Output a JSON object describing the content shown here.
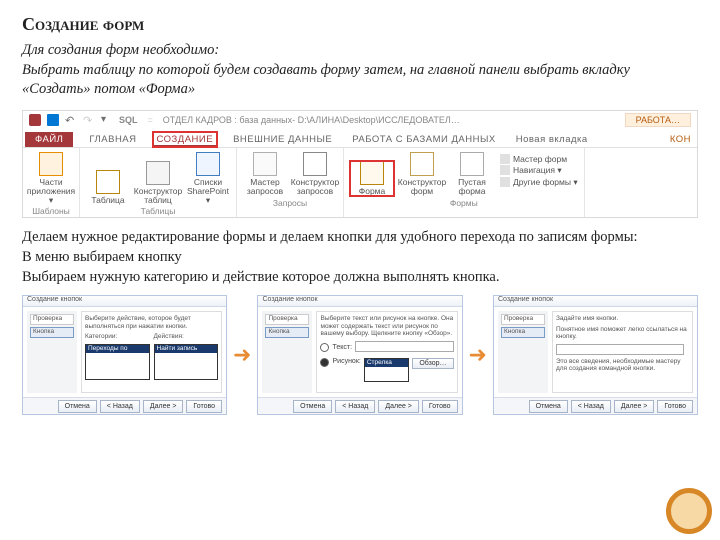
{
  "heading": "Создание форм",
  "intro": "Для создания форм необходимо:\nВыбрать таблицу по которой будем создавать форму затем, на главной панели выбрать вкладку «Создать» потом «Форма»",
  "ribbon": {
    "qat": {
      "sql": "SQL",
      "sep": "=",
      "title": "ОТДЕЛ КАДРОВ : база данных- D:\\АЛИНА\\Desktop\\ИССЛЕДОВАТЕЛ…",
      "context": "РАБОТА…"
    },
    "tabs": {
      "file": "ФАЙЛ",
      "home": "ГЛАВНАЯ",
      "create": "СОЗДАНИЕ",
      "external": "ВНЕШНИЕ ДАННЫЕ",
      "dbtools": "РАБОТА С БАЗАМИ ДАННЫХ",
      "newtab": "Новая вкладка",
      "constr": "КОН"
    },
    "groups": {
      "templates": {
        "label": "Шаблоны",
        "app": "Части приложения ▾"
      },
      "tables": {
        "label": "Таблицы",
        "table": "Таблица",
        "ctor": "Конструктор таблиц",
        "lists": "Списки SharePoint ▾"
      },
      "queries": {
        "label": "Запросы",
        "wizard": "Мастер запросов",
        "ctor": "Конструктор запросов"
      },
      "forms": {
        "label": "Формы",
        "form": "Форма",
        "ctor": "Конструктор форм",
        "blank": "Пустая форма",
        "stack": {
          "wizard": "Мастер форм",
          "nav": "Навигация ▾",
          "other": "Другие формы ▾"
        }
      }
    }
  },
  "body_text": "Делаем нужное редактирование формы и делаем кнопки для удобного перехода по записям формы:\nВ меню выбираем кнопку\nВыбираем нужную категорию и действие которое должна выполнять кнопка.",
  "dialogs": {
    "d1": {
      "title": "Создание кнопок",
      "side_label": "Проверка",
      "side_sel": "Кнопка",
      "text1": "Выберите действие, которое будет выполняться при нажатии кнопки.",
      "cat_label": "Категории:",
      "act_label": "Действия:",
      "cat_item": "Переходы по записям",
      "act_item": "Найти запись"
    },
    "d2": {
      "title": "Создание кнопок",
      "side_label": "Проверка",
      "side_sel": "Кнопка",
      "text1": "Выберите текст или рисунок на кнопке. Она может содержать текст или рисунок по вашему выбору. Щелкните кнопку «Обзор».",
      "opt_text": "Текст:",
      "opt_pic": "Рисунок:",
      "browse": "Обзор…",
      "sample": "Стрелка вправо (черная)"
    },
    "d3": {
      "title": "Создание кнопок",
      "side_label": "Проверка",
      "side_sel": "Кнопка",
      "text1": "Задайте имя кнопки.",
      "text2": "Понятное имя поможет легко ссылаться на кнопку.",
      "text3": "Это все сведения, необходимые мастеру для создания командной кнопки."
    },
    "footer": {
      "cancel": "Отмена",
      "back": "< Назад",
      "next": "Далее >",
      "finish": "Готово"
    }
  }
}
